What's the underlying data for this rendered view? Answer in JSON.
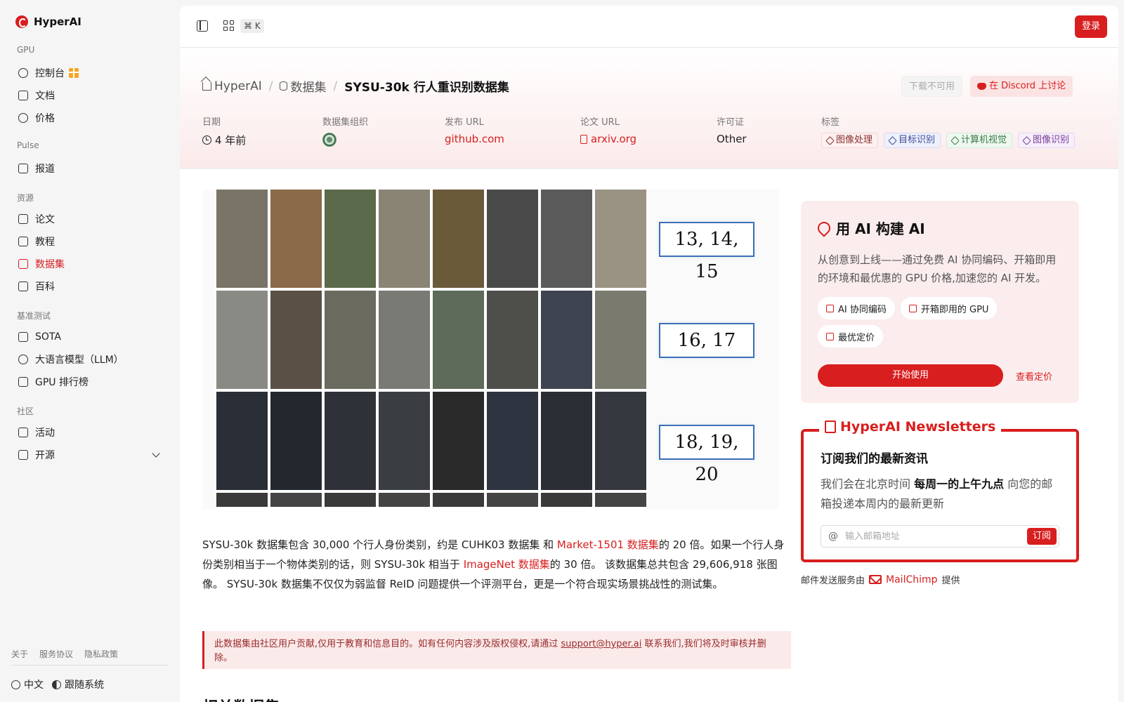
{
  "brand": {
    "name": "HyperAI"
  },
  "sidebar": {
    "sections": [
      {
        "title": "GPU",
        "items": [
          {
            "label": "控制台",
            "icon": "dashboard-icon"
          },
          {
            "label": "文档",
            "icon": "doc-icon"
          },
          {
            "label": "价格",
            "icon": "dollar-icon"
          }
        ]
      },
      {
        "title": "Pulse",
        "items": [
          {
            "label": "报道",
            "icon": "news-icon"
          }
        ]
      },
      {
        "title": "资源",
        "items": [
          {
            "label": "论文",
            "icon": "paper-icon"
          },
          {
            "label": "教程",
            "icon": "book-icon"
          },
          {
            "label": "数据集",
            "icon": "database-icon"
          },
          {
            "label": "百科",
            "icon": "wiki-icon"
          }
        ]
      },
      {
        "title": "基准测试",
        "items": [
          {
            "label": "SOTA",
            "icon": "chart-icon"
          },
          {
            "label": "大语言模型（LLM）",
            "icon": "sparkle-icon"
          },
          {
            "label": "GPU 排行榜",
            "icon": "chip-icon"
          }
        ]
      },
      {
        "title": "社区",
        "items": [
          {
            "label": "活动",
            "icon": "calendar-icon"
          },
          {
            "label": "开源",
            "icon": "list-icon"
          }
        ]
      }
    ],
    "footer_links": [
      "关于",
      "服务协议",
      "隐私政策"
    ],
    "language": "中文",
    "theme": "跟随系统"
  },
  "topbar": {
    "shortcut": "⌘ K",
    "login": "登录"
  },
  "breadcrumb": {
    "home": "HyperAI",
    "section": "数据集",
    "current": "SYSU-30k 行人重识别数据集"
  },
  "actions": {
    "download": "下载不可用",
    "discord": "在 Discord 上讨论"
  },
  "meta": {
    "date_label": "日期",
    "date": "4 年前",
    "org_label": "数据集组织",
    "release_label": "发布 URL",
    "release": "github.com",
    "paper_label": "论文 URL",
    "paper": "arxiv.org",
    "license_label": "许可证",
    "license": "Other",
    "tags_label": "标签",
    "tags": [
      "图像处理",
      "目标识别",
      "计算机视觉",
      "图像识别"
    ]
  },
  "hero": {
    "labels": [
      "13, 14, 15",
      "16, 17",
      "18, 19, 20"
    ]
  },
  "description": {
    "p1": "SYSU-30k 数据集包含 30,000 个行人身份类别，约是 CUHK03 数据集 和 ",
    "link1": "Market-1501 数据集",
    "p2": "的 20 倍。如果一个行人身份类别相当于一个物体类别的话，则 SYSU-30k 相当于 ",
    "link2": "ImageNet 数据集",
    "p3": "的 30 倍。 该数据集总共包含 29,606,918 张图像。 SYSU-30k 数据集不仅仅为弱监督 ReID 问题提供一个评测平台，更是一个符合现实场景挑战性的测试集。"
  },
  "notice": {
    "text": "此数据集由社区用户贡献,仅用于教育和信息目的。如有任何内容涉及版权侵权,请通过 ",
    "email": "support@hyper.ai",
    "text2": " 联系我们,我们将及时审核并删除。"
  },
  "related_title": "相关数据集",
  "ai_card": {
    "title": "用 AI 构建 AI",
    "desc": "从创意到上线——通过免费 AI 协同编码、开箱即用的环境和最优惠的 GPU 价格,加速您的 AI 开发。",
    "chips": [
      "AI 协同编码",
      "开箱即用的 GPU",
      "最优定价"
    ],
    "start": "开始使用",
    "pricing": "查看定价"
  },
  "newsletter": {
    "legend": "HyperAI Newsletters",
    "subtitle": "订阅我们的最新资讯",
    "desc_pre": "我们会在北京时间 ",
    "desc_bold": "每周一的上午九点",
    "desc_post": " 向您的邮箱投递本周内的最新更新",
    "placeholder": "输入邮箱地址",
    "subscribe": "订阅",
    "credit_pre": "邮件发送服务由",
    "credit_brand": "MailChimp",
    "credit_post": "提供"
  },
  "colors": {
    "accent": "#d81e1e"
  }
}
